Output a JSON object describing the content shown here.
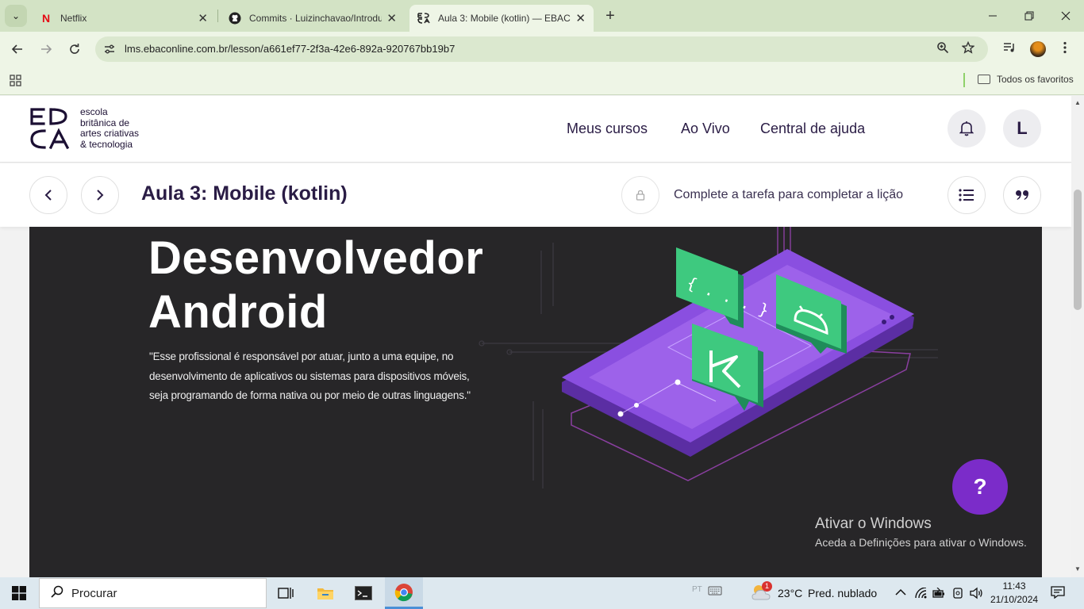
{
  "browser": {
    "tabs": [
      {
        "title": "Netflix",
        "icon": "netflix-icon",
        "active": false
      },
      {
        "title": "Commits · Luizinchavao/Introdu",
        "icon": "github-icon",
        "active": false
      },
      {
        "title": "Aula 3: Mobile (kotlin) — EBAC",
        "icon": "ebac-icon",
        "active": true
      }
    ],
    "url": "lms.ebaconline.com.br/lesson/a661ef77-2f3a-42e6-892a-920767bb19b7",
    "bookmarks_folder": "Todos os favoritos"
  },
  "site": {
    "logo_text": [
      "escola",
      "britânica de",
      "artes criativas",
      "& tecnologia"
    ],
    "nav": [
      "Meus cursos",
      "Ao Vivo",
      "Central de ajuda"
    ],
    "avatar_letter": "L"
  },
  "lesson": {
    "title": "Aula 3: Mobile (kotlin)",
    "complete_text": "Complete a tarefa para completar a lição"
  },
  "hero": {
    "title_line1": "Desenvolvedor",
    "title_line2": "Android",
    "quote_line1": "\"Esse profissional é responsável por atuar, junto a uma equipe, no",
    "quote_line2": "desenvolvimento de aplicativos ou sistemas para dispositivos móveis,",
    "quote_line3": "seja programando de forma nativa ou por meio de outras linguagens.\"",
    "code_glyph": "{ . . . }"
  },
  "help_label": "?",
  "watermark": {
    "title": "Ativar o Windows",
    "subtitle": "Aceda a Definições para ativar o Windows."
  },
  "taskbar": {
    "search_label": "Procurar",
    "weather_temp": "23°C",
    "weather_desc": "Pred. nublado",
    "weather_badge": "1",
    "time": "11:43",
    "date": "21/10/2024",
    "lang": "PT"
  },
  "colors": {
    "accent": "#7b2cc9",
    "hero_bg": "#272628",
    "browser_frame": "#d3e3c5"
  }
}
